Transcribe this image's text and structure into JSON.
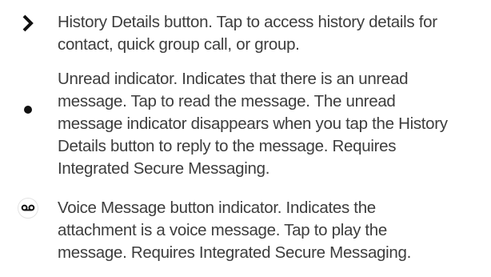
{
  "items": [
    {
      "icon": "chevron-right-icon",
      "lines": [
        "History Details button. Tap to access history details for",
        "contact, quick group call, or group."
      ]
    },
    {
      "icon": "unread-dot-icon",
      "lines": [
        "Unread indicator. Indicates that there is an unread",
        "message. Tap to read the message. The unread",
        "message indicator disappears when you tap the History",
        "Details button to reply to the message. Requires",
        "Integrated Secure Messaging."
      ]
    },
    {
      "icon": "voicemail-icon",
      "lines": [
        "Voice Message button indicator. Indicates the",
        "attachment is a voice message. Tap to play the",
        "message. Requires Integrated Secure Messaging."
      ]
    }
  ],
  "colors": {
    "text": "#3d3d3d",
    "icon": "#111111"
  }
}
